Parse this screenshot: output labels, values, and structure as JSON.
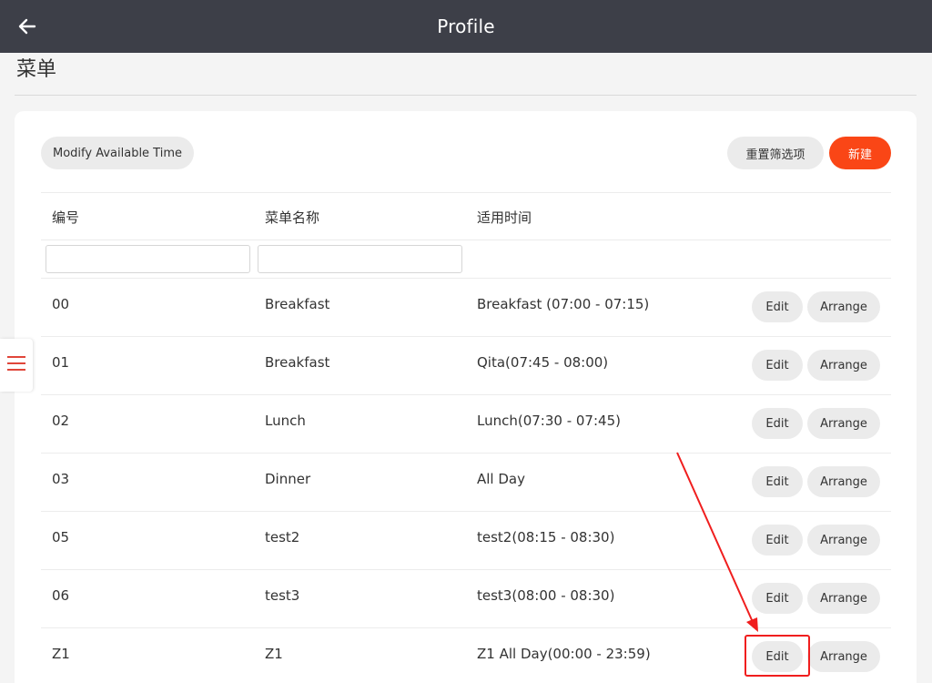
{
  "header": {
    "title": "Profile",
    "back_icon": "arrow-left-icon",
    "background": "#3d3f48"
  },
  "page": {
    "heading": "菜单"
  },
  "toolbar": {
    "modify_time_label": "Modify Available Time",
    "reset_filters_label": "重置筛选项",
    "new_label": "新建",
    "accent_color": "#fa4616"
  },
  "table": {
    "columns": [
      "编号",
      "菜单名称",
      "适用时间"
    ],
    "filters": {
      "id_value": "",
      "name_value": ""
    },
    "rows": [
      {
        "id": "00",
        "name": "Breakfast",
        "time": "Breakfast (07:00 - 07:15)",
        "edit_label": "Edit",
        "arrange_label": "Arrange"
      },
      {
        "id": "01",
        "name": "Breakfast",
        "time": "Qita(07:45 - 08:00)",
        "edit_label": "Edit",
        "arrange_label": "Arrange"
      },
      {
        "id": "02",
        "name": "Lunch",
        "time": "Lunch(07:30 - 07:45)",
        "edit_label": "Edit",
        "arrange_label": "Arrange"
      },
      {
        "id": "03",
        "name": "Dinner",
        "time": "All Day",
        "edit_label": "Edit",
        "arrange_label": "Arrange"
      },
      {
        "id": "05",
        "name": "test2",
        "time": "test2(08:15 - 08:30)",
        "edit_label": "Edit",
        "arrange_label": "Arrange"
      },
      {
        "id": "06",
        "name": "test3",
        "time": "test3(08:00 - 08:30)",
        "edit_label": "Edit",
        "arrange_label": "Arrange"
      },
      {
        "id": "Z1",
        "name": "Z1",
        "time": "Z1 All Day(00:00 - 23:59)",
        "edit_label": "Edit",
        "arrange_label": "Arrange"
      }
    ]
  },
  "sidebar_toggle": {
    "icon": "hamburger-menu-icon",
    "color": "#e0463a"
  },
  "annotation": {
    "highlight_color": "#f01e1e",
    "target": "edit-button-row-Z1"
  }
}
